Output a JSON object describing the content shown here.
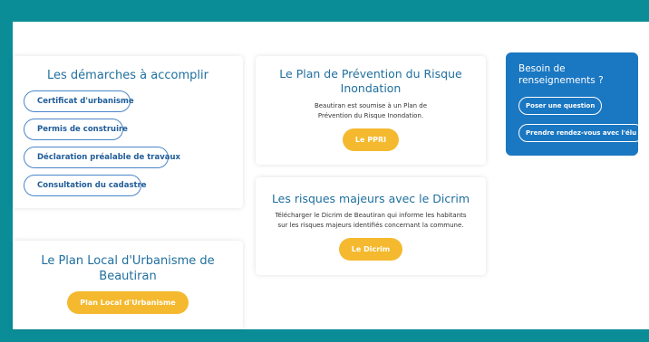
{
  "demarches": {
    "title": "Les démarches à accomplir",
    "items": [
      "Certificat d'urbanisme",
      "Permis de construire",
      "Déclaration préalable de travaux",
      "Consultation du cadastre"
    ]
  },
  "plu": {
    "title": "Le Plan Local d'Urbanisme de Beautiran",
    "button": "Plan Local d'Urbanisme"
  },
  "ppri": {
    "title": "Le Plan de Prévention du Risque Inondation",
    "description": "Beautiran est soumise à un Plan de Prévention du Risque Inondation.",
    "button": "Le PPRI"
  },
  "dicrim": {
    "title": "Les risques majeurs avec le Dicrim",
    "description": "Télécharger le Dicrim de Beautiran qui informe les habitants sur les risques majeurs identifiés concernant la commune.",
    "button": "Le Dicrim"
  },
  "help": {
    "title": "Besoin de renseignements ?",
    "question_button": "Poser une question",
    "appointment_button": "Prendre rendez-vous avec l'élu"
  },
  "colors": {
    "frame": "#0b8d98",
    "title_blue": "#1f6f9e",
    "accent_yellow": "#f4b92e",
    "help_blue": "#1a77c2"
  }
}
